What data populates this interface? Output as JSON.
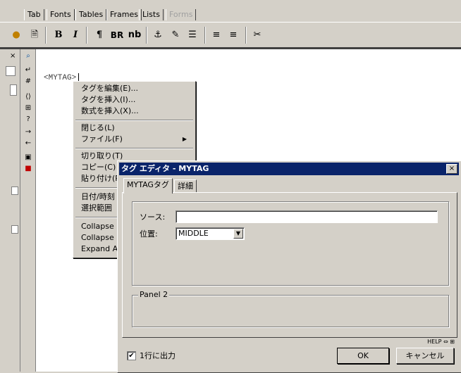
{
  "tabs": [
    "Tab",
    "Fonts",
    "Tables",
    "Frames",
    "Lists",
    "Forms"
  ],
  "toolbar": {
    "bold": "B",
    "italic": "I",
    "para": "¶",
    "br": "BR",
    "nb": "nb",
    "anchor": "⚓"
  },
  "sidebar_icons": [
    "search-icon",
    "return-icon",
    "hash-icon",
    "comment-icon",
    "link-icon",
    "help-icon",
    "arrow-right-icon",
    "arrow-left-icon",
    "screen-icon",
    "color-icon"
  ],
  "editor": {
    "text": "<MYTAG>"
  },
  "context_menu": {
    "items": [
      "タグを編集(E)...",
      "タグを挿入(I)...",
      "数式を挿入(X)...",
      "閉じる(L)",
      "ファイル(F)",
      "切り取り(T)",
      "コピー(C)",
      "貼り付け(P)",
      "日付/時刻",
      "選択範囲",
      "Collapse",
      "Collapse",
      "Expand A"
    ]
  },
  "dialog": {
    "title": "タグ エディタ - MYTAG",
    "close": "×",
    "tab_main": "MYTAGタグ",
    "tab_detail": "詳細",
    "source_label": "ソース:",
    "source_value": "",
    "position_label": "位置:",
    "position_value": "MIDDLE",
    "panel2_label": "Panel 2",
    "help": "HELP ⇔ ⊞",
    "checkbox_label": "1行に出力",
    "checkbox_checked": true,
    "ok": "OK",
    "cancel": "キャンセル"
  }
}
